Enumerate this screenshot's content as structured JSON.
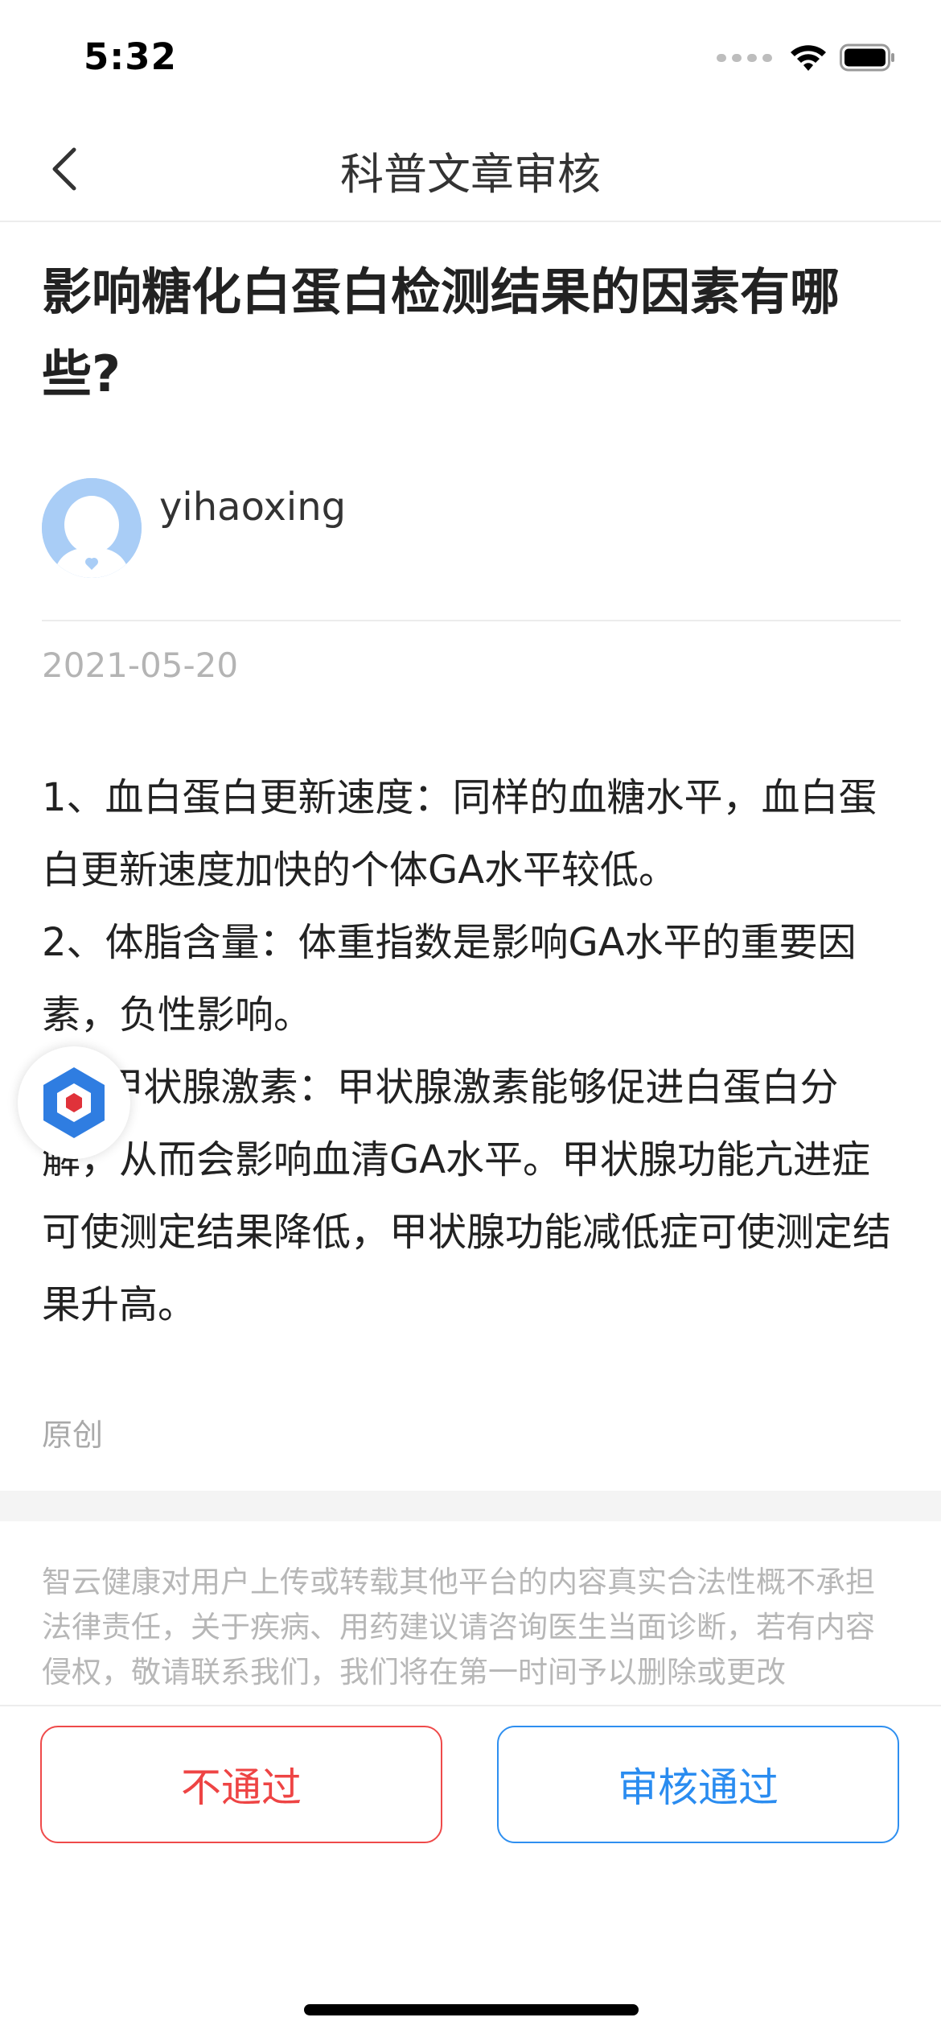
{
  "status_bar": {
    "time": "5:32",
    "icons": [
      "signal-icon",
      "wifi-icon",
      "battery-icon"
    ]
  },
  "nav": {
    "title": "科普文章审核",
    "back_icon": "chevron-left-icon"
  },
  "article": {
    "title": "影响糖化白蛋白检测结果的因素有哪些?",
    "author": {
      "name": "yihaoxing",
      "avatar_icon": "default-user-avatar-icon"
    },
    "date": "2021-05-20",
    "paragraphs": [
      "1、血白蛋白更新速度：同样的血糖水平，血白蛋白更新速度加快的个体GA水平较低。",
      "2、体脂含量：体重指数是影响GA水平的重要因素，负性影响。",
      "3、甲状腺激素：甲状腺激素能够促进白蛋白分解，从而会影响血清GA水平。甲状腺功能亢进症可使测定结果降低，甲状腺功能减低症可使测定结果升高。"
    ],
    "source_tag": "原创"
  },
  "disclaimer": "智云健康对用户上传或转载其他平台的内容真实合法性概不承担法律责任，关于疾病、用药建议请咨询医生当面诊断，若有内容侵权，敬请联系我们，我们将在第一时间予以删除或更改",
  "actions": {
    "reject_label": "不通过",
    "approve_label": "审核通过"
  },
  "colors": {
    "reject": "#ee4444",
    "approve": "#2a8cf0",
    "muted_text": "#b4b4b4",
    "avatar_bg": "#a9cdf6",
    "assistant_blue": "#2f7de1",
    "assistant_red": "#e0323a"
  },
  "floating_assistant_icon": "hexagon-assistant-icon"
}
